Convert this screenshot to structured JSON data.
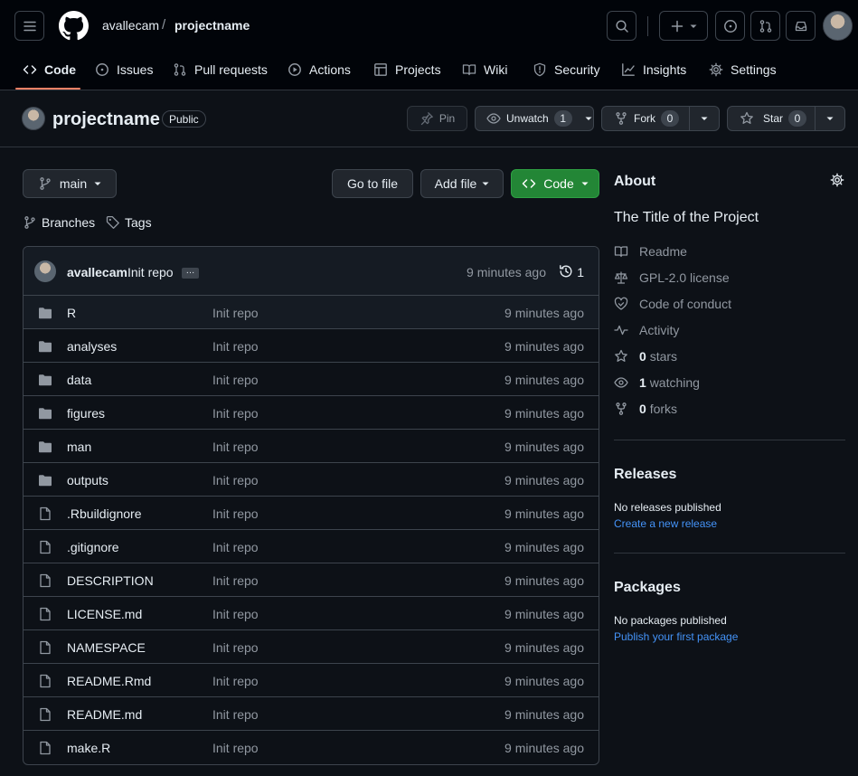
{
  "header": {
    "owner": "avallecam",
    "separator": "/",
    "repo": "projectname"
  },
  "tabs": [
    {
      "label": "Code",
      "icon": "code-icon"
    },
    {
      "label": "Issues",
      "icon": "issue-opened-icon"
    },
    {
      "label": "Pull requests",
      "icon": "git-pull-request-icon"
    },
    {
      "label": "Actions",
      "icon": "play-icon"
    },
    {
      "label": "Projects",
      "icon": "table-icon"
    },
    {
      "label": "Wiki",
      "icon": "book-icon"
    },
    {
      "label": "Security",
      "icon": "shield-icon"
    },
    {
      "label": "Insights",
      "icon": "graph-icon"
    },
    {
      "label": "Settings",
      "icon": "gear-icon"
    }
  ],
  "repo": {
    "name": "projectname",
    "visibility": "Public",
    "pin_label": "Pin",
    "watch_label": "Unwatch",
    "watch_count": "1",
    "fork_label": "Fork",
    "fork_count": "0",
    "star_label": "Star",
    "star_count": "0"
  },
  "toolbar": {
    "branch": "main",
    "goto_file": "Go to file",
    "add_file": "Add file",
    "code": "Code",
    "branches": "Branches",
    "tags": "Tags"
  },
  "commit": {
    "author": "avallecam",
    "message": "Init repo",
    "more": "…",
    "time": "9 minutes ago",
    "count": "1"
  },
  "files": [
    {
      "type": "dir",
      "name": "R",
      "commit": "Init repo",
      "time": "9 minutes ago"
    },
    {
      "type": "dir",
      "name": "analyses",
      "commit": "Init repo",
      "time": "9 minutes ago"
    },
    {
      "type": "dir",
      "name": "data",
      "commit": "Init repo",
      "time": "9 minutes ago"
    },
    {
      "type": "dir",
      "name": "figures",
      "commit": "Init repo",
      "time": "9 minutes ago"
    },
    {
      "type": "dir",
      "name": "man",
      "commit": "Init repo",
      "time": "9 minutes ago"
    },
    {
      "type": "dir",
      "name": "outputs",
      "commit": "Init repo",
      "time": "9 minutes ago"
    },
    {
      "type": "file",
      "name": ".Rbuildignore",
      "commit": "Init repo",
      "time": "9 minutes ago"
    },
    {
      "type": "file",
      "name": ".gitignore",
      "commit": "Init repo",
      "time": "9 minutes ago"
    },
    {
      "type": "file",
      "name": "DESCRIPTION",
      "commit": "Init repo",
      "time": "9 minutes ago"
    },
    {
      "type": "file",
      "name": "LICENSE.md",
      "commit": "Init repo",
      "time": "9 minutes ago"
    },
    {
      "type": "file",
      "name": "NAMESPACE",
      "commit": "Init repo",
      "time": "9 minutes ago"
    },
    {
      "type": "file",
      "name": "README.Rmd",
      "commit": "Init repo",
      "time": "9 minutes ago"
    },
    {
      "type": "file",
      "name": "README.md",
      "commit": "Init repo",
      "time": "9 minutes ago"
    },
    {
      "type": "file",
      "name": "make.R",
      "commit": "Init repo",
      "time": "9 minutes ago"
    }
  ],
  "about": {
    "title": "About",
    "description": "The Title of the Project",
    "readme": "Readme",
    "license": "GPL-2.0 license",
    "conduct": "Code of conduct",
    "activity": "Activity",
    "stars_count": "0",
    "stars_label": "stars",
    "watching_count": "1",
    "watching_label": "watching",
    "forks_count": "0",
    "forks_label": "forks"
  },
  "releases": {
    "title": "Releases",
    "empty": "No releases published",
    "link": "Create a new release"
  },
  "packages": {
    "title": "Packages",
    "empty": "No packages published",
    "link": "Publish your first package"
  },
  "colors": {
    "accent_underline": "#f78166",
    "code_button": "#238636",
    "link": "#4493f8"
  }
}
